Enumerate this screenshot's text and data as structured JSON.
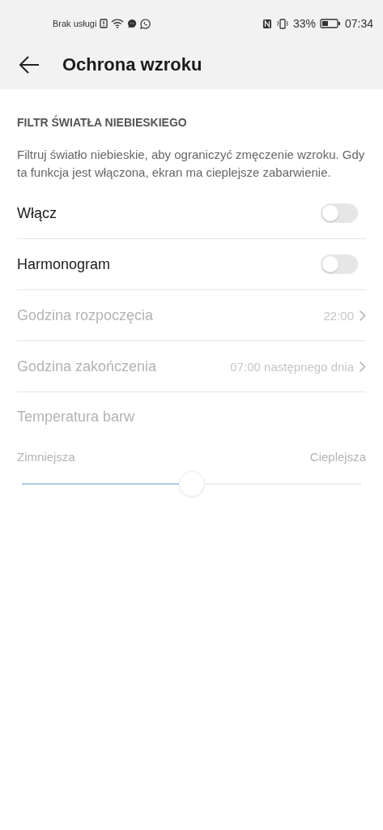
{
  "status_bar": {
    "carrier": "Brak usługi",
    "battery_percent": "33%",
    "time": "07:34"
  },
  "header": {
    "title": "Ochrona wzroku"
  },
  "section": {
    "title": "FILTR ŚWIATŁA NIEBIESKIEGO",
    "description": "Filtruj światło niebieskie, aby ograniczyć zmęczenie wzroku. Gdy ta funkcja jest włączona, ekran ma cieplejsze zabarwienie."
  },
  "rows": [
    {
      "kind": "toggle",
      "label": "Włącz",
      "on": false,
      "disabled": false
    },
    {
      "kind": "toggle",
      "label": "Harmonogram",
      "on": false,
      "disabled": false
    },
    {
      "kind": "link",
      "label": "Godzina rozpoczęcia",
      "value": "22:00",
      "disabled": true
    },
    {
      "kind": "link",
      "label": "Godzina zakończenia",
      "value": "07:00 następnego dnia",
      "disabled": true
    },
    {
      "kind": "slider",
      "label": "Temperatura barw",
      "min_label": "Zimniejsza",
      "max_label": "Cieplejsza",
      "level": 0.5,
      "disabled": true
    }
  ]
}
